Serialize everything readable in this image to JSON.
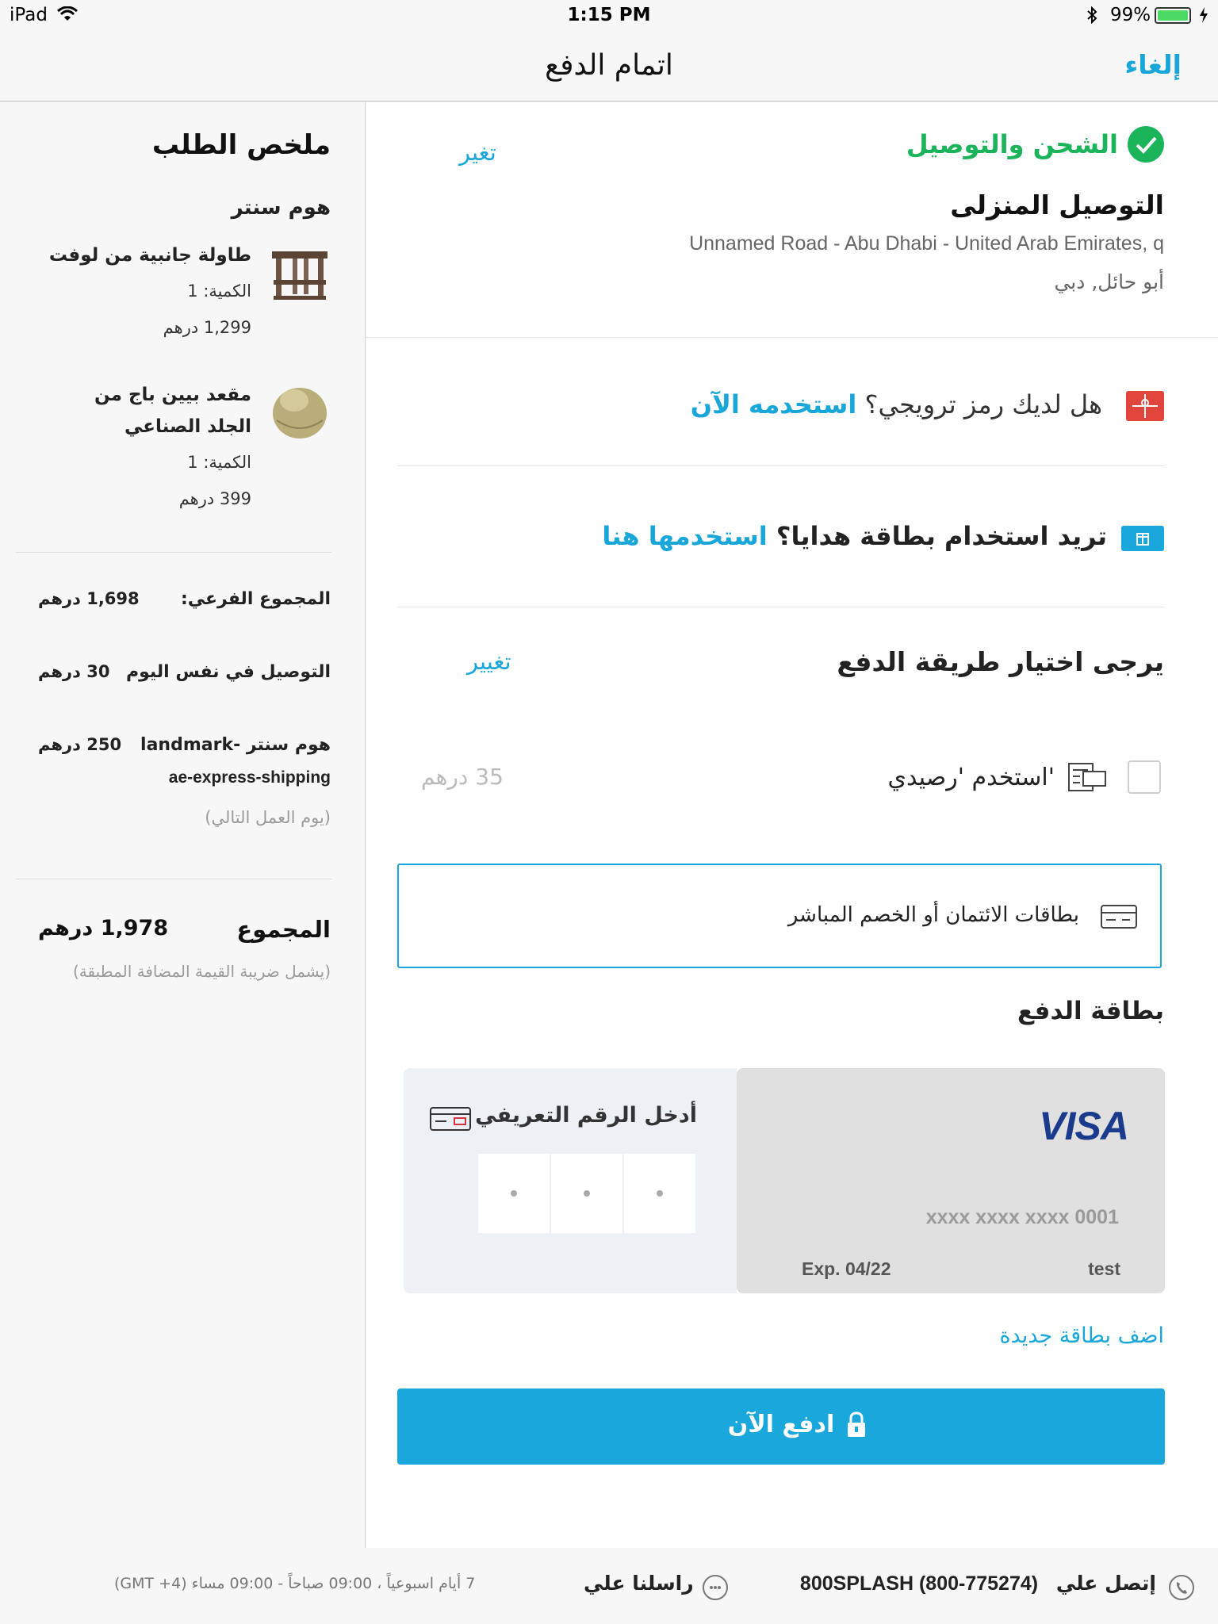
{
  "status": {
    "device": "iPad",
    "time": "1:15 PM",
    "battery": "99%"
  },
  "nav": {
    "title": "اتمام الدفع",
    "cancel": "إلغاء"
  },
  "shipping": {
    "title": "الشحن والتوصيل",
    "change": "تغير",
    "method": "التوصيل المنزلى",
    "address_line": "Unnamed Road - Abu Dhabi - United Arab Emirates, q",
    "area": "أبو حائل, دبي"
  },
  "promo": {
    "question": "هل لديك رمز ترويجي؟",
    "link": "استخدمه الآن"
  },
  "giftcard": {
    "question": "تريد استخدام بطاقة هدايا؟",
    "link": "استخدمها هنا"
  },
  "payment": {
    "title": "يرجى اختيار طريقة الدفع",
    "change": "تغيير",
    "credit_label": "'استخدم 'رصيدي",
    "credit_amount": "35 درهم",
    "method_label": "بطاقات الائتمان أو الخصم المباشر",
    "card_section_title": "بطاقة الدفع",
    "card_number": "xxxx xxxx xxxx 0001",
    "card_exp": "Exp. 04/22",
    "card_name": "test",
    "card_brand": "VISA",
    "cvv_label": "أدخل الرقم التعريفي",
    "add_card": "اضف بطاقة جديدة",
    "pay_button": "ادفع الآن"
  },
  "summary": {
    "title": "ملخص الطلب",
    "store": "هوم سنتر",
    "items": [
      {
        "name": "طاولة جانبية من لوفت",
        "qty": "الكمية: 1",
        "price": "1,299 درهم"
      },
      {
        "name_line1": "مقعد بيين باج من",
        "name_line2": "الجلد الصناعي",
        "qty": "الكمية: 1",
        "price": "399 درهم"
      }
    ],
    "subtotal_label": "المجموع الفرعي:",
    "subtotal_value": "1,698 درهم",
    "sameday_label": "التوصيل في نفس اليوم",
    "sameday_value": "30 درهم",
    "express_label_line1": "هوم سنتر -landmark",
    "express_label_line2": "ae-express-shipping",
    "express_value": "250 درهم",
    "express_note": "(يوم العمل التالي)",
    "total_label": "المجموع",
    "total_value": "1,978 درهم",
    "vat_note": "(يشمل ضريبة القيمة المضافة المطبقة)"
  },
  "footer": {
    "call_label": "إتصل علي",
    "call_number": "800SPLASH (800-775274)",
    "chat_label": "راسلنا علي",
    "hours": "7 أيام اسبوعياً ، 09:00 صباحاً - 09:00 مساء (GMT +4)"
  },
  "colors": {
    "accent": "#19a6d9",
    "success": "#1bb45a",
    "promo_red": "#e0443a"
  }
}
